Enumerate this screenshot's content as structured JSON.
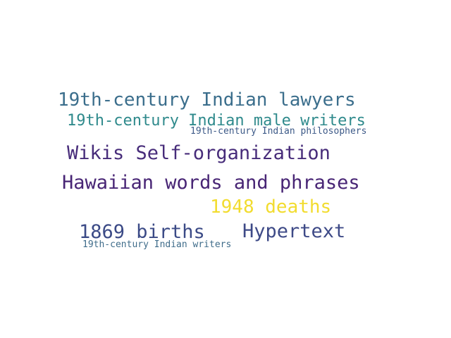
{
  "word_cloud": {
    "words": [
      {
        "text": "19th-century Indian lawyers",
        "color": "#3b6e8c"
      },
      {
        "text": "19th-century Indian male writers",
        "color": "#2f8a8c"
      },
      {
        "text": "19th-century Indian philosophers",
        "color": "#3d5a88"
      },
      {
        "text": "Wikis Self-organization",
        "color": "#472c7a"
      },
      {
        "text": "Hawaiian words and phrases",
        "color": "#482575"
      },
      {
        "text": "1948 deaths",
        "color": "#f2dc2f"
      },
      {
        "text": "1869 births",
        "color": "#3b4a86"
      },
      {
        "text": "Hypertext",
        "color": "#3e4a87"
      },
      {
        "text": "19th-century Indian writers",
        "color": "#3f6c8a"
      }
    ]
  }
}
